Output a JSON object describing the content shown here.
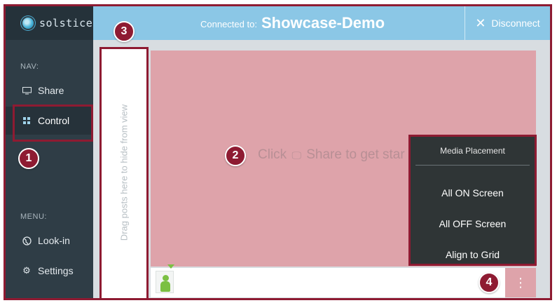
{
  "app": {
    "logo_text": "solstice"
  },
  "header": {
    "connected_prefix": "Connected to:",
    "display_name": "Showcase-Demo",
    "disconnect_label": "Disconnect"
  },
  "sidebar": {
    "nav_title": "NAV:",
    "nav_items": [
      {
        "label": "Share",
        "icon": "monitor-icon"
      },
      {
        "label": "Control",
        "icon": "grid-icon",
        "active": true
      }
    ],
    "menu_title": "MENU:",
    "menu_items": [
      {
        "label": "Look-in",
        "icon": "globe-icon"
      },
      {
        "label": "Settings",
        "icon": "gear-icon"
      }
    ]
  },
  "drag_area": {
    "label": "Drag posts here to hide from view"
  },
  "workspace": {
    "hint_prefix": "Click",
    "hint_suffix": "Share to get star"
  },
  "media_menu": {
    "title": "Media Placement",
    "items": [
      "All ON Screen",
      "All OFF Screen",
      "Align to Grid"
    ]
  },
  "callouts": [
    "1",
    "2",
    "3",
    "4"
  ],
  "colors": {
    "accent": "#8e1b32",
    "topbar": "#8bc7e6",
    "sidebar": "#2f3d46",
    "workspace": "#dea3aa",
    "menu": "#2f3536",
    "post_green": "#7bc043"
  }
}
